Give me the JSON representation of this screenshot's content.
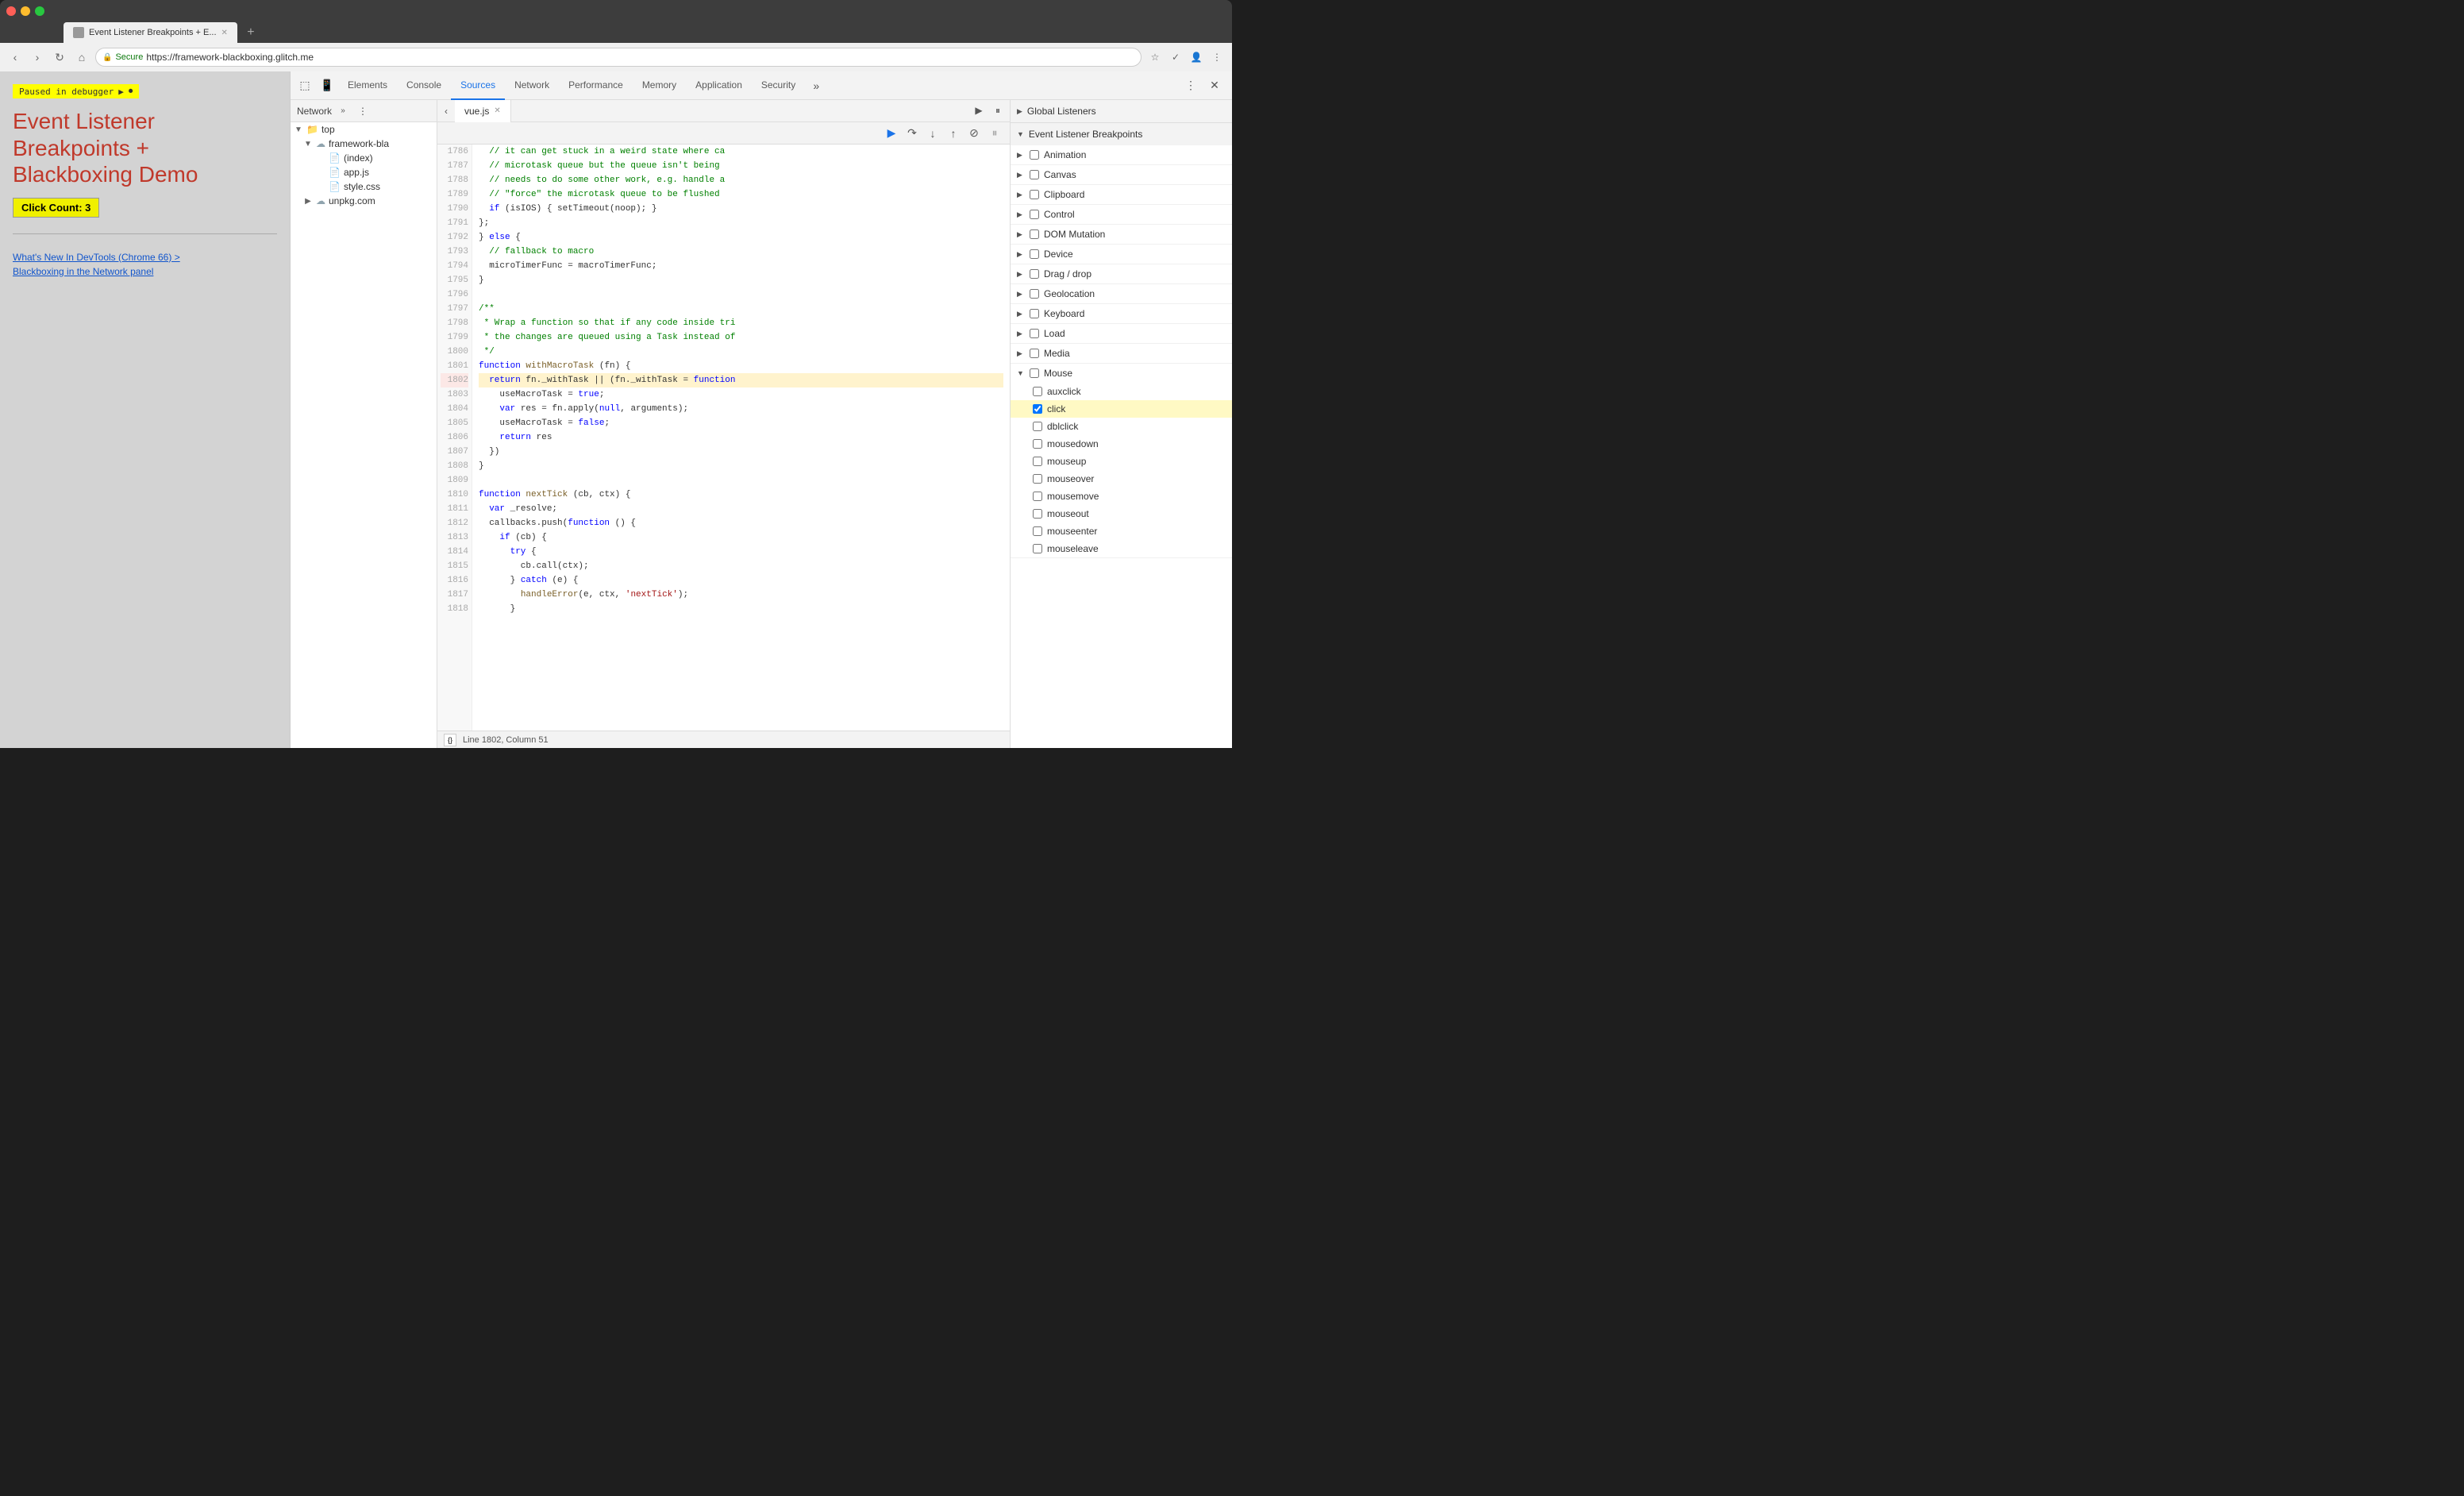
{
  "browser": {
    "tab_title": "Event Listener Breakpoints + E...",
    "url": "https://framework-blackboxing.glitch.me",
    "secure_label": "Secure"
  },
  "webpage": {
    "paused_label": "Paused in debugger",
    "title_line1": "Event Listener",
    "title_line2": "Breakpoints +",
    "title_line3": "Blackboxing Demo",
    "click_count_label": "Click Count: 3",
    "link1": "What's New In DevTools (Chrome 66) >",
    "link2": "Blackboxing in the Network panel"
  },
  "devtools": {
    "tabs": [
      "Elements",
      "Console",
      "Sources",
      "Network",
      "Performance",
      "Memory",
      "Application",
      "Security"
    ],
    "active_tab": "Sources"
  },
  "sources_panel": {
    "network_label": "Network",
    "overflow_btn": "»",
    "file_tree": [
      {
        "type": "folder",
        "label": "top",
        "indent": 0,
        "expanded": true
      },
      {
        "type": "folder",
        "label": "framework-bla",
        "indent": 1,
        "expanded": true,
        "cloud": true
      },
      {
        "type": "file",
        "label": "(index)",
        "indent": 2,
        "file_type": "html"
      },
      {
        "type": "file",
        "label": "app.js",
        "indent": 2,
        "file_type": "js"
      },
      {
        "type": "file",
        "label": "style.css",
        "indent": 2,
        "file_type": "css"
      },
      {
        "type": "folder",
        "label": "unpkg.com",
        "indent": 1,
        "expanded": false,
        "cloud": true
      }
    ]
  },
  "editor": {
    "tab_filename": "vue.js",
    "lines": [
      {
        "num": 1786,
        "content": "  // it can get stuck in a weird state where ca",
        "type": "comment"
      },
      {
        "num": 1787,
        "content": "  // microtask queue but the queue isn't being",
        "type": "comment"
      },
      {
        "num": 1788,
        "content": "  // needs to do some other work, e.g. handle a",
        "type": "comment"
      },
      {
        "num": 1789,
        "content": "  // \"force\" the microtask queue to be flushed",
        "type": "comment"
      },
      {
        "num": 1790,
        "content": "  if (isIOS) { setTimeout(noop); }",
        "type": "code"
      },
      {
        "num": 1791,
        "content": "};",
        "type": "code"
      },
      {
        "num": 1792,
        "content": "} else {",
        "type": "code"
      },
      {
        "num": 1793,
        "content": "  // fallback to macro",
        "type": "comment"
      },
      {
        "num": 1794,
        "content": "  microTimerFunc = macroTimerFunc;",
        "type": "code"
      },
      {
        "num": 1795,
        "content": "}",
        "type": "code"
      },
      {
        "num": 1796,
        "content": "",
        "type": "code"
      },
      {
        "num": 1797,
        "content": "/**",
        "type": "comment"
      },
      {
        "num": 1798,
        "content": " * Wrap a function so that if any code inside tri",
        "type": "comment"
      },
      {
        "num": 1799,
        "content": " * the changes are queued using a Task instead of",
        "type": "comment"
      },
      {
        "num": 1800,
        "content": " */",
        "type": "comment"
      },
      {
        "num": 1801,
        "content": "function withMacroTask (fn) {",
        "type": "code"
      },
      {
        "num": 1802,
        "content": "  return fn._withTask || (fn._withTask = function",
        "type": "code",
        "highlighted": true
      },
      {
        "num": 1803,
        "content": "    useMacroTask = true;",
        "type": "code"
      },
      {
        "num": 1804,
        "content": "    var res = fn.apply(null, arguments);",
        "type": "code"
      },
      {
        "num": 1805,
        "content": "    useMacroTask = false;",
        "type": "code"
      },
      {
        "num": 1806,
        "content": "    return res",
        "type": "code"
      },
      {
        "num": 1807,
        "content": "  })",
        "type": "code"
      },
      {
        "num": 1808,
        "content": "}",
        "type": "code"
      },
      {
        "num": 1809,
        "content": "",
        "type": "code"
      },
      {
        "num": 1810,
        "content": "function nextTick (cb, ctx) {",
        "type": "code"
      },
      {
        "num": 1811,
        "content": "  var _resolve;",
        "type": "code"
      },
      {
        "num": 1812,
        "content": "  callbacks.push(function () {",
        "type": "code"
      },
      {
        "num": 1813,
        "content": "    if (cb) {",
        "type": "code"
      },
      {
        "num": 1814,
        "content": "      try {",
        "type": "code"
      },
      {
        "num": 1815,
        "content": "        cb.call(ctx);",
        "type": "code"
      },
      {
        "num": 1816,
        "content": "      } catch (e) {",
        "type": "code"
      },
      {
        "num": 1817,
        "content": "        handleError(e, ctx, 'nextTick');",
        "type": "code"
      },
      {
        "num": 1818,
        "content": "      }",
        "type": "code"
      }
    ],
    "status_bar": "Line 1802, Column 51"
  },
  "right_panel": {
    "global_listeners_label": "Global Listeners",
    "event_breakpoints_label": "Event Listener Breakpoints",
    "categories": [
      {
        "label": "Animation",
        "expanded": false,
        "checked": false
      },
      {
        "label": "Canvas",
        "expanded": false,
        "checked": false
      },
      {
        "label": "Clipboard",
        "expanded": false,
        "checked": false
      },
      {
        "label": "Control",
        "expanded": false,
        "checked": false
      },
      {
        "label": "DOM Mutation",
        "expanded": false,
        "checked": false
      },
      {
        "label": "Device",
        "expanded": false,
        "checked": false
      },
      {
        "label": "Drag / drop",
        "expanded": false,
        "checked": false
      },
      {
        "label": "Geolocation",
        "expanded": false,
        "checked": false
      },
      {
        "label": "Keyboard",
        "expanded": false,
        "checked": false
      },
      {
        "label": "Load",
        "expanded": false,
        "checked": false
      },
      {
        "label": "Media",
        "expanded": false,
        "checked": false
      },
      {
        "label": "Mouse",
        "expanded": true,
        "checked": false
      }
    ],
    "mouse_items": [
      {
        "label": "auxclick",
        "checked": false,
        "active": false
      },
      {
        "label": "click",
        "checked": true,
        "active": true
      },
      {
        "label": "dblclick",
        "checked": false,
        "active": false
      },
      {
        "label": "mousedown",
        "checked": false,
        "active": false
      },
      {
        "label": "mouseup",
        "checked": false,
        "active": false
      },
      {
        "label": "mouseover",
        "checked": false,
        "active": false
      },
      {
        "label": "mousemove",
        "checked": false,
        "active": false
      },
      {
        "label": "mouseout",
        "checked": false,
        "active": false
      },
      {
        "label": "mouseenter",
        "checked": false,
        "active": false
      },
      {
        "label": "mouseleave",
        "checked": false,
        "active": false
      }
    ]
  },
  "debug_toolbar": {
    "buttons": [
      "resume",
      "step-over",
      "step-into",
      "step-out",
      "deactivate-breakpoints",
      "pause-on-exception"
    ]
  }
}
